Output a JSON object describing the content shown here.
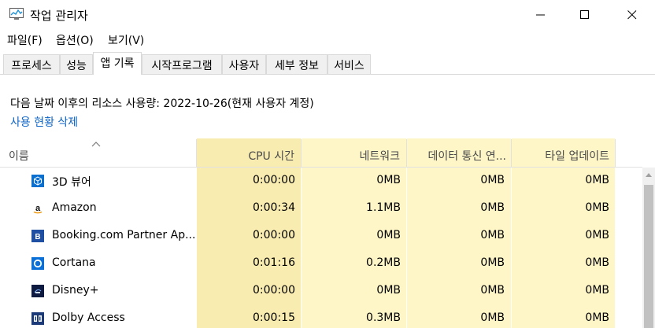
{
  "window": {
    "title": "작업 관리자",
    "controls": {
      "minimize": "minimize",
      "maximize": "maximize",
      "close": "close"
    }
  },
  "menu": [
    "파일(F)",
    "옵션(O)",
    "보기(V)"
  ],
  "tabs": [
    {
      "label": "프로세스",
      "active": false
    },
    {
      "label": "성능",
      "active": false
    },
    {
      "label": "앱 기록",
      "active": true
    },
    {
      "label": "시작프로그램",
      "active": false
    },
    {
      "label": "사용자",
      "active": false
    },
    {
      "label": "세부 정보",
      "active": false
    },
    {
      "label": "서비스",
      "active": false
    }
  ],
  "history": {
    "info": "다음 날짜 이후의 리소스 사용량: 2022-10-26(현재 사용자 계정)",
    "delete_link": "사용 현황 삭제"
  },
  "table": {
    "columns": [
      "이름",
      "CPU 시간",
      "네트워크",
      "데이터 통신 연...",
      "타일 업데이트"
    ],
    "rows": [
      {
        "name": "3D 뷰어",
        "icon": "3d-viewer-icon",
        "cpu": "0:00:00",
        "network": "0MB",
        "metered": "0MB",
        "tile": "0MB"
      },
      {
        "name": "Amazon",
        "icon": "amazon-icon",
        "cpu": "0:00:34",
        "network": "1.1MB",
        "metered": "0MB",
        "tile": "0MB"
      },
      {
        "name": "Booking.com Partner Ap...",
        "icon": "booking-icon",
        "cpu": "0:00:00",
        "network": "0MB",
        "metered": "0MB",
        "tile": "0MB"
      },
      {
        "name": "Cortana",
        "icon": "cortana-icon",
        "cpu": "0:01:16",
        "network": "0.2MB",
        "metered": "0MB",
        "tile": "0MB"
      },
      {
        "name": "Disney+",
        "icon": "disney-plus-icon",
        "cpu": "0:00:00",
        "network": "0MB",
        "metered": "0MB",
        "tile": "0MB"
      },
      {
        "name": "Dolby Access",
        "icon": "dolby-access-icon",
        "cpu": "0:00:15",
        "network": "0.3MB",
        "metered": "0MB",
        "tile": "0MB"
      }
    ]
  },
  "colors": {
    "highlight": "#fff6c8",
    "highlight_strong": "#f9ecb0",
    "link": "#0b63c5",
    "tab_inactive": "#f0f0f0"
  }
}
